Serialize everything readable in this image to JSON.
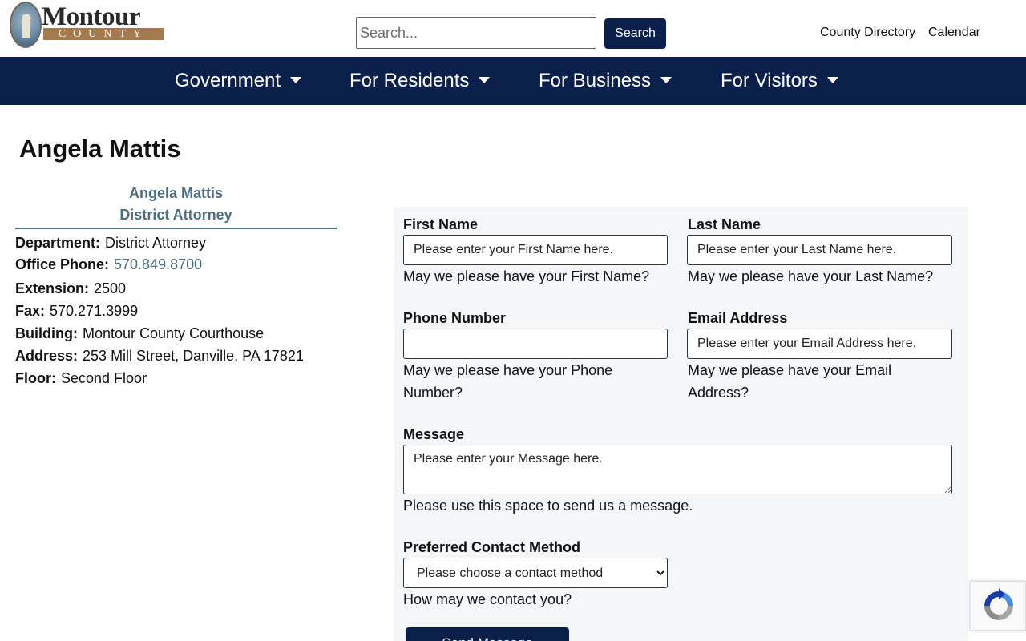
{
  "header": {
    "logo": {
      "word": "Montour",
      "county": "COUNTY"
    },
    "search": {
      "placeholder": "Search...",
      "button_label": "Search"
    },
    "util_links": {
      "directory": "County Directory",
      "calendar": "Calendar"
    }
  },
  "nav": {
    "items": [
      {
        "label": "Government"
      },
      {
        "label": "For Residents"
      },
      {
        "label": "For Business"
      },
      {
        "label": "For Visitors"
      }
    ]
  },
  "page": {
    "title": "Angela Mattis"
  },
  "contact": {
    "name": "Angela Mattis",
    "title": "District Attorney",
    "rows": [
      {
        "label": "Department:",
        "value": "District Attorney"
      },
      {
        "label": "Office Phone:",
        "value": "570.849.8700"
      },
      {
        "label": "Extension:",
        "value": "2500"
      },
      {
        "label": "Fax:",
        "value": "570.271.3999"
      },
      {
        "label": "Building:",
        "value": "Montour County Courthouse"
      },
      {
        "label": "Address:",
        "value": "253 Mill Street, Danville, PA 17821"
      },
      {
        "label": "Floor:",
        "value": "Second Floor"
      }
    ]
  },
  "form": {
    "first_name": {
      "label": "First Name",
      "placeholder": "Please enter your First Name here.",
      "help": "May we please have your First Name?"
    },
    "last_name": {
      "label": "Last Name",
      "placeholder": "Please enter your Last Name here.",
      "help": "May we please have your Last Name?"
    },
    "phone": {
      "label": "Phone Number",
      "placeholder": "",
      "help_line1": "May we please have your Phone",
      "help_line2": "Number?"
    },
    "email": {
      "label": "Email Address",
      "placeholder": "Please enter your Email Address here.",
      "help_line1": "May we please have your Email",
      "help_line2": "Address?"
    },
    "message": {
      "label": "Message",
      "placeholder": "Please enter your Message here.",
      "help": "Please use this space to send us a message."
    },
    "contact_method": {
      "label": "Preferred Contact Method",
      "selected": "Please choose a contact method",
      "help": "How may we contact you?"
    },
    "submit_label": "Send Message"
  },
  "colors": {
    "navy": "#0b1f4b",
    "accent_teal": "#4e6f7f",
    "panel": "#f5f6f7"
  }
}
